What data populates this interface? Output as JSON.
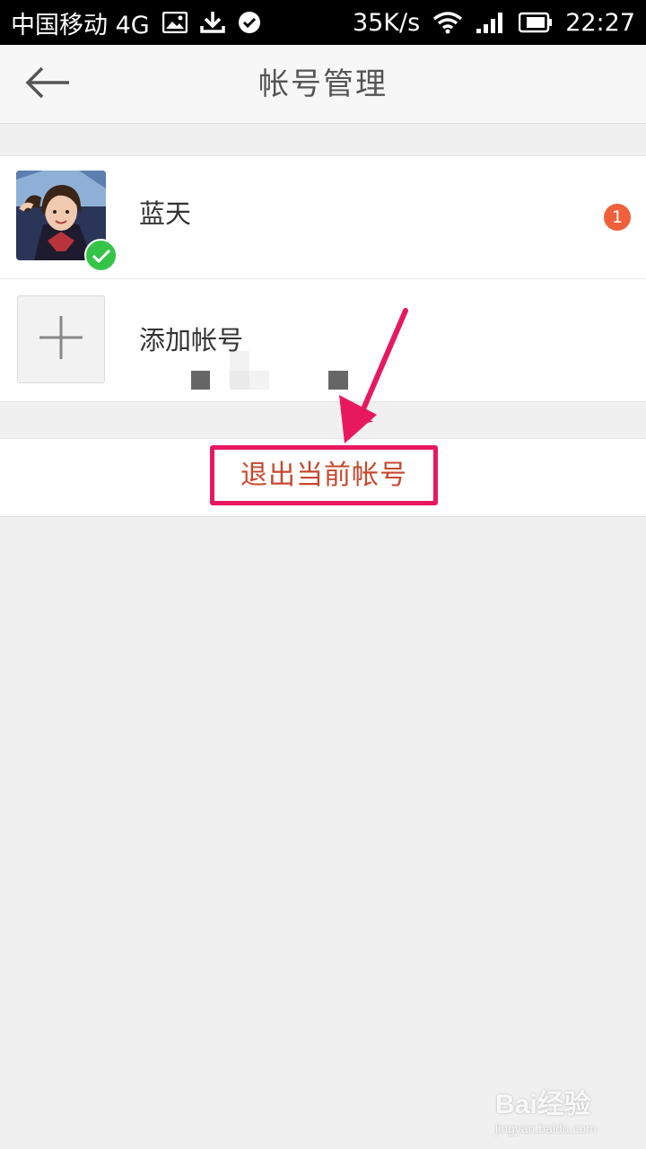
{
  "status_bar": {
    "carrier": "中国移动 4G",
    "net_speed": "35K/s",
    "time": "22:27",
    "icons": [
      "image-icon",
      "download-icon",
      "check-circle-icon",
      "wifi-icon",
      "signal-icon",
      "battery-icon"
    ]
  },
  "header": {
    "title": "帐号管理",
    "back_icon": "back-arrow-icon"
  },
  "accounts": [
    {
      "name": "蓝天",
      "selected": true,
      "unread_count": "1"
    }
  ],
  "add_account": {
    "label": "添加帐号",
    "icon": "plus-icon"
  },
  "logout": {
    "label": "退出当前帐号"
  },
  "annotation": {
    "arrow_color": "#e8185f",
    "highlight_color": "#e8185f"
  },
  "colors": {
    "accent_check": "#34c548",
    "badge": "#f0603a",
    "logout_text": "#c6482e",
    "background": "#f0f0f0"
  },
  "watermark": {
    "logo": "Bai经验",
    "url": "jingyan.baidu.com"
  }
}
